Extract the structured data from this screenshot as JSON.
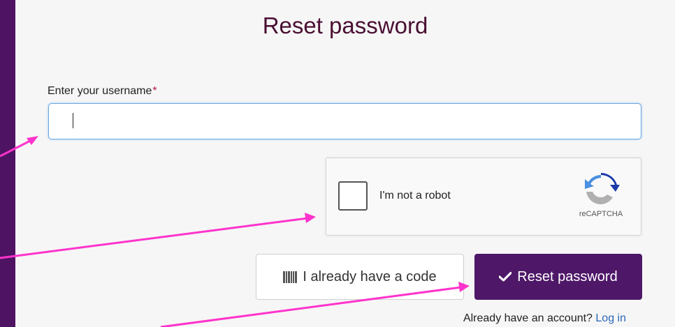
{
  "page": {
    "title": "Reset password"
  },
  "form": {
    "username_label": "Enter your username",
    "required_marker": "*",
    "username_value": ""
  },
  "captcha": {
    "label": "I'm not a robot",
    "brand": "reCAPTCHA",
    "checked": false
  },
  "buttons": {
    "have_code_label": "I already have a code",
    "reset_label": "Reset password"
  },
  "footer": {
    "prompt": "Already have an account?",
    "login_link": "Log in"
  },
  "icons": {
    "have_code": "barcode-icon",
    "reset": "checkmark-icon",
    "captcha": "recaptcha-logo-icon"
  },
  "colors": {
    "background": "#4f1363",
    "primary_button": "#4e1768",
    "title": "#4a0f33",
    "required": "#b3124f",
    "link": "#2a67b5",
    "annotation_arrows": "#ff33cc"
  }
}
